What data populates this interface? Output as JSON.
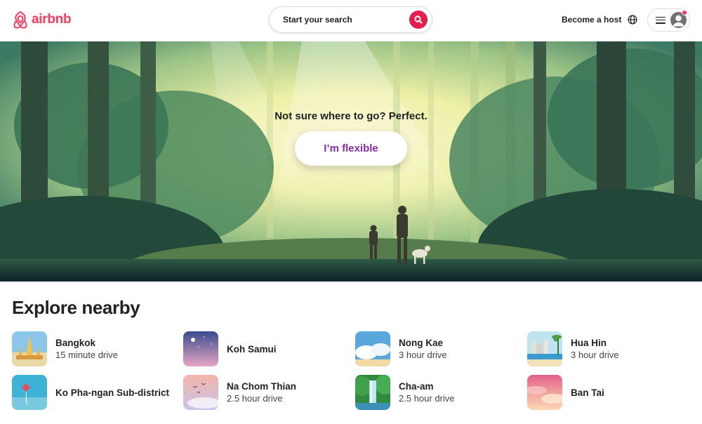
{
  "header": {
    "logo_text": "airbnb",
    "search_label": "Start your search",
    "become_host": "Become a host"
  },
  "hero": {
    "title": "Not sure where to go? Perfect.",
    "button_label": "I’m flexible"
  },
  "explore": {
    "title": "Explore nearby",
    "items": [
      {
        "name": "Bangkok",
        "sub": "15 minute drive"
      },
      {
        "name": "Koh Samui",
        "sub": ""
      },
      {
        "name": "Nong Kae",
        "sub": "3 hour drive"
      },
      {
        "name": "Hua Hin",
        "sub": "3 hour drive"
      },
      {
        "name": "Ko Pha-ngan Sub-district",
        "sub": ""
      },
      {
        "name": "Na Chom Thian",
        "sub": "2.5 hour drive"
      },
      {
        "name": "Cha-am",
        "sub": "2.5 hour drive"
      },
      {
        "name": "Ban Tai",
        "sub": ""
      }
    ]
  },
  "colors": {
    "brand": "#FF385C",
    "search_button": "#E61E4D",
    "flexible_text": "#8A2BB0"
  },
  "icons": [
    "airbnb-logo-icon",
    "search-icon",
    "globe-icon",
    "menu-icon",
    "user-avatar-icon"
  ]
}
